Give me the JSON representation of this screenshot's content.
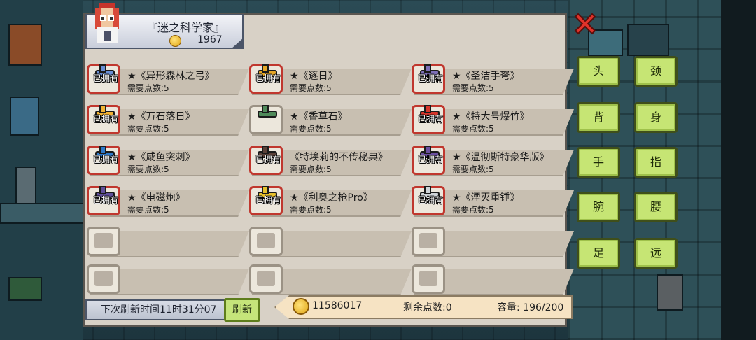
{
  "header": {
    "title": "『迷之科学家』",
    "coins": "1967"
  },
  "owned_label": "已拥有",
  "items": [
    {
      "name": "★《异形森林之弓》",
      "cost": "需要点数:5",
      "owned": true,
      "icon": "alien-bow-icon",
      "color": "#6a8fd6"
    },
    {
      "name": "★《逐日》",
      "cost": "需要点数:5",
      "owned": true,
      "icon": "sun-chaser-bow-icon",
      "color": "#e6a727"
    },
    {
      "name": "★《圣洁手弩》",
      "cost": "需要点数:5",
      "owned": true,
      "icon": "holy-crossbow-icon",
      "color": "#7d6fb8"
    },
    {
      "name": "★《万石落日》",
      "cost": "需要点数:5",
      "owned": true,
      "icon": "sunset-bow-icon",
      "color": "#f2b233"
    },
    {
      "name": "★《香草石》",
      "cost": "需要点数:5",
      "owned": false,
      "icon": "vanilla-stone-icon",
      "color": "#4f8a5a"
    },
    {
      "name": "★《特大号爆竹》",
      "cost": "需要点数:5",
      "owned": true,
      "icon": "firecracker-icon",
      "color": "#d7352b"
    },
    {
      "name": "★《咸鱼突刺》",
      "cost": "需要点数:5",
      "owned": true,
      "icon": "salted-fish-icon",
      "color": "#2d78c9"
    },
    {
      "name": "《特埃莉的不传秘典》",
      "cost": "需要点数:5",
      "owned": true,
      "icon": "secret-tome-icon",
      "color": "#5a4038"
    },
    {
      "name": "★《温彻斯特豪华版》",
      "cost": "需要点数:5",
      "owned": true,
      "icon": "winchester-rifle-icon",
      "color": "#6b4fa0"
    },
    {
      "name": "★《电磁炮》",
      "cost": "需要点数:5",
      "owned": true,
      "icon": "railgun-icon",
      "color": "#5f4f9a"
    },
    {
      "name": "★《利奥之枪Pro》",
      "cost": "需要点数:5",
      "owned": true,
      "icon": "leo-gun-icon",
      "color": "#e6c02c"
    },
    {
      "name": "★《湮灭重锤》",
      "cost": "需要点数:5",
      "owned": true,
      "icon": "annihilation-hammer-icon",
      "color": "#cfd4d8"
    }
  ],
  "footer": {
    "refresh_time": "下次刷新时间11时31分07",
    "refresh_button": "刷新",
    "coins": "11586017",
    "remaining_points": "剩余点数:0",
    "capacity": "容量: 196/200"
  },
  "body_slots": [
    "头",
    "颈",
    "背",
    "身",
    "手",
    "指",
    "腕",
    "腰",
    "足",
    "远"
  ]
}
